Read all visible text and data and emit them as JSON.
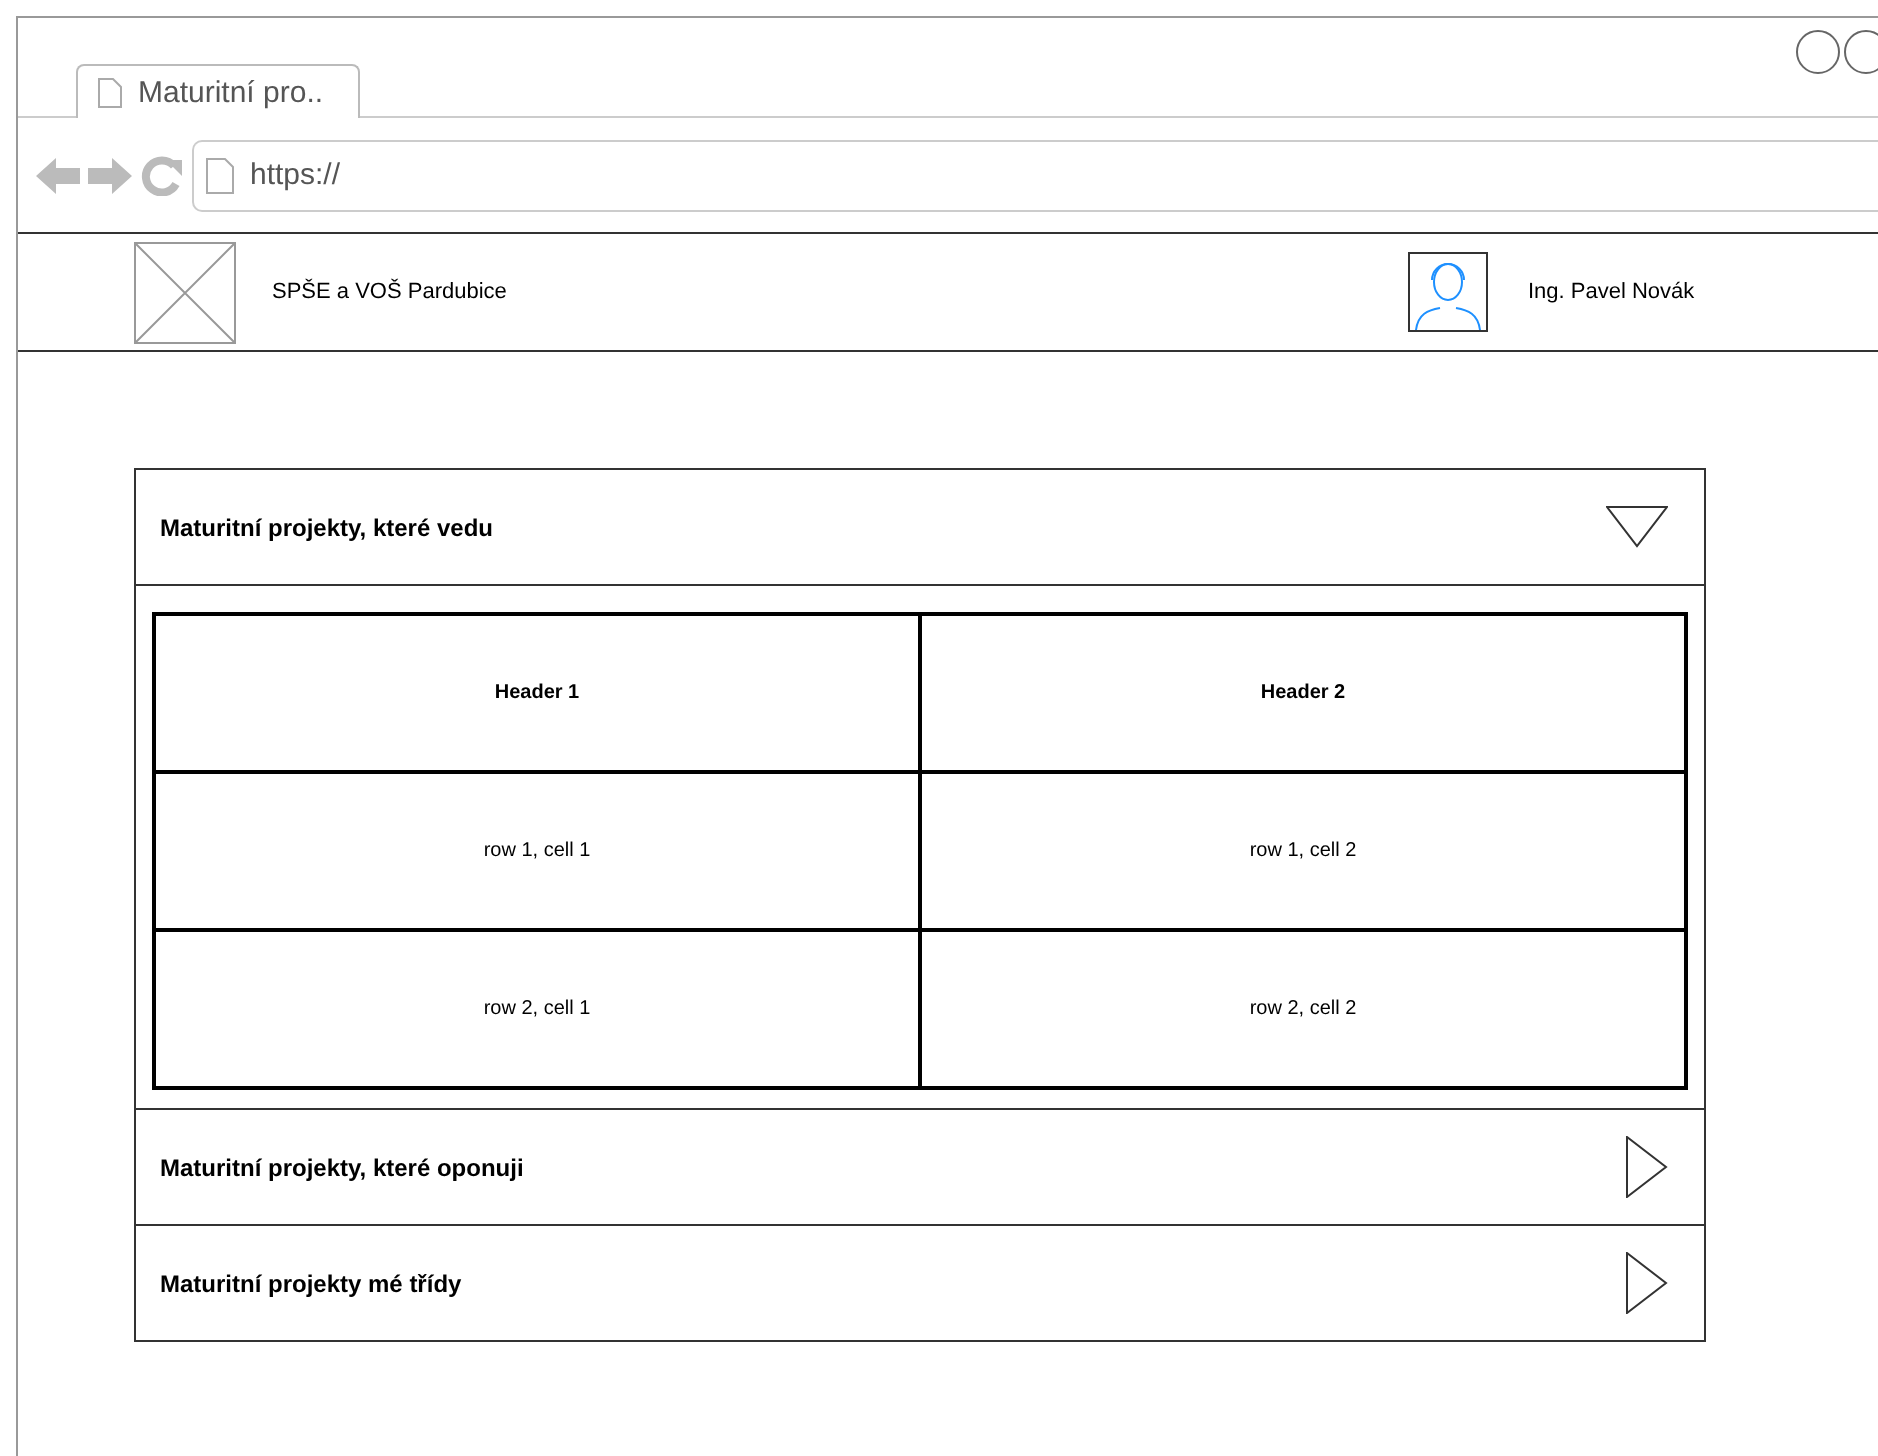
{
  "browser": {
    "tab_title": "Maturitní pro..",
    "url": "https://"
  },
  "header": {
    "school": "SPŠE a VOŠ Pardubice",
    "user": "Ing. Pavel Novák"
  },
  "sections": [
    {
      "title": "Maturitní projekty, které vedu",
      "expanded": true,
      "table": {
        "columns": [
          "Header 1",
          "Header 2"
        ],
        "rows": [
          [
            "row 1, cell 1",
            "row 1, cell 2"
          ],
          [
            "row 2, cell 1",
            "row 2, cell 2"
          ]
        ]
      }
    },
    {
      "title": "Maturitní projekty, které oponuji",
      "expanded": false
    },
    {
      "title": "Maturitní projekty mé třídy",
      "expanded": false
    }
  ]
}
